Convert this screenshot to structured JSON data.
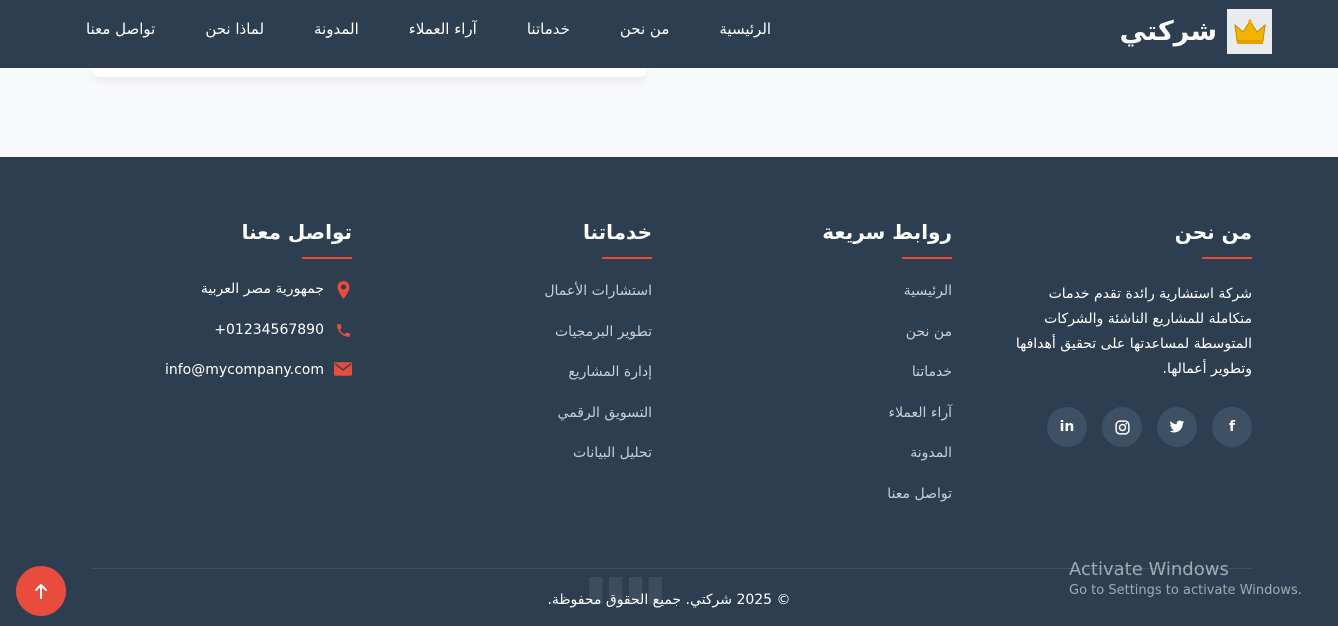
{
  "brand": {
    "name": "شركتي",
    "logo_icon": "crown-icon"
  },
  "nav": [
    {
      "label": "الرئيسية"
    },
    {
      "label": "من نحن"
    },
    {
      "label": "خدماتنا"
    },
    {
      "label": "آراء العملاء"
    },
    {
      "label": "المدونة"
    },
    {
      "label": "لماذا نحن"
    },
    {
      "label": "تواصل معنا"
    }
  ],
  "about": {
    "title": "من نحن",
    "text": "شركة استشارية رائدة تقدم خدمات متكاملة للمشاريع الناشئة والشركات المتوسطة لمساعدتها على تحقيق أهدافها وتطوير أعمالها.",
    "social": [
      {
        "icon": "facebook-icon",
        "glyph": "f"
      },
      {
        "icon": "twitter-icon",
        "glyph": ""
      },
      {
        "icon": "instagram-icon",
        "glyph": ""
      },
      {
        "icon": "linkedin-icon",
        "glyph": "in"
      }
    ]
  },
  "quick_links": {
    "title": "روابط سريعة",
    "items": [
      "الرئيسية",
      "من نحن",
      "خدماتنا",
      "آراء العملاء",
      "المدونة",
      "تواصل معنا"
    ]
  },
  "services": {
    "title": "خدماتنا",
    "items": [
      "استشارات الأعمال",
      "تطوير البرمجيات",
      "إدارة المشاريع",
      "التسويق الرقمي",
      "تحليل البيانات"
    ]
  },
  "contact": {
    "title": "تواصل معنا",
    "items": [
      {
        "icon": "map-marker-icon",
        "text": "جمهورية مصر العربية"
      },
      {
        "icon": "phone-icon",
        "text": "+01234567890"
      },
      {
        "icon": "envelope-icon",
        "text": "info@mycompany.com"
      }
    ]
  },
  "footer": {
    "copyright": "© 2025 شركتي. جميع الحقوق محفوظة."
  },
  "windows_activation": {
    "title": "Activate Windows",
    "subtitle": "Go to Settings to activate Windows."
  },
  "colors": {
    "primary_bg": "#2d3e50",
    "accent": "#e74c3c",
    "social_bg": "#3e5064",
    "band_bg": "#f8f9fc"
  }
}
